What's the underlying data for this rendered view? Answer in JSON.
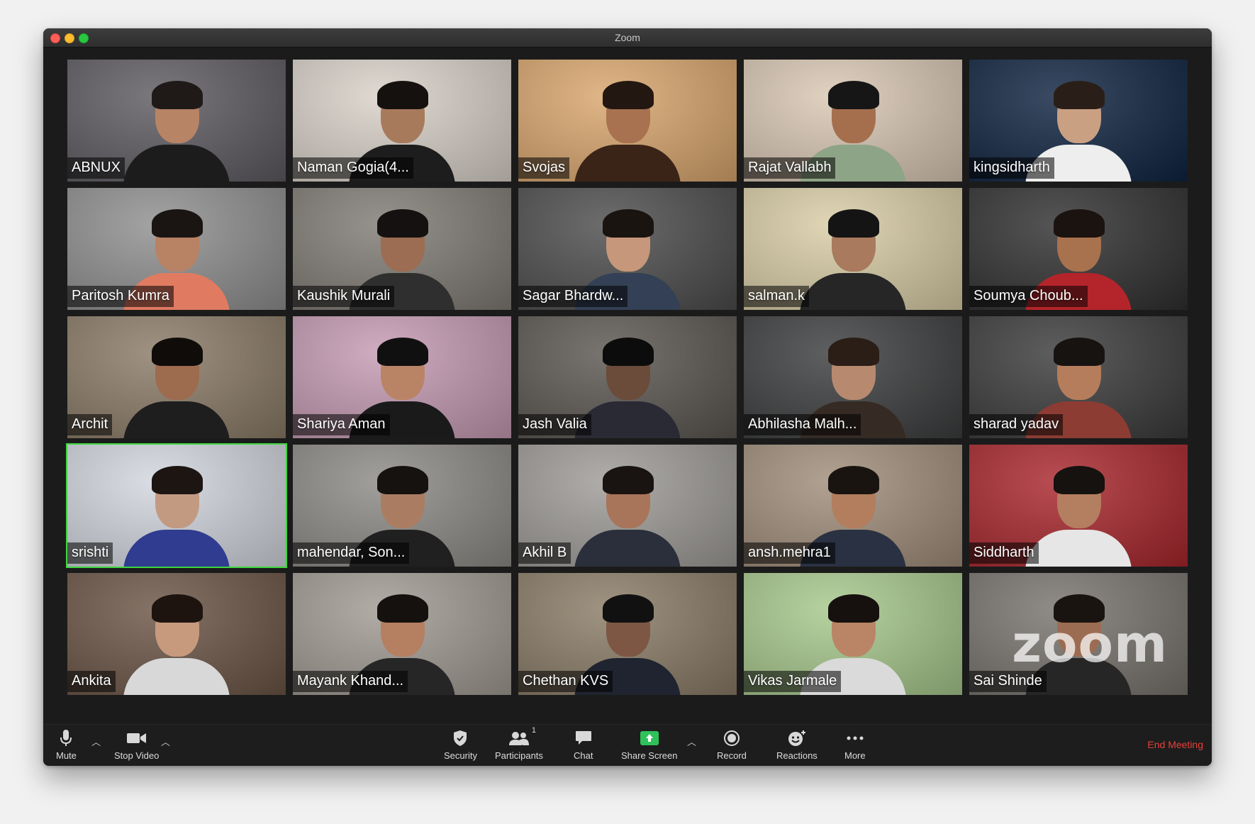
{
  "window": {
    "title": "Zoom"
  },
  "participants": [
    {
      "name": "ABNUX",
      "bg": "#5d5a60",
      "skin": "#b88466",
      "hair": "#1f1a18",
      "shirt": "#1c1c1c"
    },
    {
      "name": "Naman Gogia(4...",
      "bg": "#d8d1c8",
      "skin": "#a87a5c",
      "hair": "#15110f",
      "shirt": "#1d1d1d"
    },
    {
      "name": "Svojas",
      "bg": "#d9a66d",
      "skin": "#a8714f",
      "hair": "#231711",
      "shirt": "#3a2418"
    },
    {
      "name": "Rajat Vallabh",
      "bg": "#d9c7b3",
      "skin": "#a56f4e",
      "hair": "#161616",
      "shirt": "#8ea486"
    },
    {
      "name": "kingsidharth",
      "bg": "#0e2340",
      "skin": "#caa083",
      "hair": "#2a1f18",
      "shirt": "#eeeeee"
    },
    {
      "name": "Paritosh Kumra",
      "bg": "#8f8f8f",
      "skin": "#b88264",
      "hair": "#1a1512",
      "shirt": "#e07b62"
    },
    {
      "name": "Kaushik Murali",
      "bg": "#7f7a73",
      "skin": "#9c6d52",
      "hair": "#141110",
      "shirt": "#2f2f2f"
    },
    {
      "name": "Sagar Bhardw...",
      "bg": "#4c4c4c",
      "skin": "#c6977a",
      "hair": "#1a1410",
      "shirt": "#334055"
    },
    {
      "name": "salman.k",
      "bg": "#d9cda6",
      "skin": "#a97a5d",
      "hair": "#141414",
      "shirt": "#262626"
    },
    {
      "name": "Soumya Choub...",
      "bg": "#2f2f2f",
      "skin": "#a8724f",
      "hair": "#1a1310",
      "shirt": "#b3252a"
    },
    {
      "name": "Archit",
      "bg": "#8a7a66",
      "skin": "#9d6b4e",
      "hair": "#0f0c0a",
      "shirt": "#1e1e1e"
    },
    {
      "name": "Shariya Aman",
      "bg": "#c59ab2",
      "skin": "#b98466",
      "hair": "#111010",
      "shirt": "#1a1a1a"
    },
    {
      "name": "Jash Valia",
      "bg": "#5a5550",
      "skin": "#6b4b3a",
      "hair": "#0c0c0c",
      "shirt": "#2a2a35"
    },
    {
      "name": "Abhilasha Malh...",
      "bg": "#3b3c3d",
      "skin": "#b78a70",
      "hair": "#2a1e17",
      "shirt": "#352b24"
    },
    {
      "name": "sharad yadav",
      "bg": "#3a3a3a",
      "skin": "#b57d5b",
      "hair": "#171311",
      "shirt": "#8c3c33"
    },
    {
      "name": "srishti",
      "bg": "#d2d6de",
      "skin": "#c29a82",
      "hair": "#1c1512",
      "shirt": "#2f3c8f"
    },
    {
      "name": "mahendar, Son...",
      "bg": "#8c8a86",
      "skin": "#aa7d62",
      "hair": "#16120f",
      "shirt": "#202020"
    },
    {
      "name": "Akhil B",
      "bg": "#9e9b97",
      "skin": "#a8745a",
      "hair": "#191411",
      "shirt": "#2a2f3b"
    },
    {
      "name": "ansh.mehra1",
      "bg": "#a08d7a",
      "skin": "#b27e5e",
      "hair": "#1a1410",
      "shirt": "#2a3142"
    },
    {
      "name": "Siddharth",
      "bg": "#a8262c",
      "skin": "#b47e60",
      "hair": "#161210",
      "shirt": "#e6e6e6"
    },
    {
      "name": "Ankita",
      "bg": "#6b5445",
      "skin": "#c79a7e",
      "hair": "#1d1410",
      "shirt": "#d8d8d8"
    },
    {
      "name": "Mayank Khand...",
      "bg": "#a09a92",
      "skin": "#b57f62",
      "hair": "#15110f",
      "shirt": "#262626"
    },
    {
      "name": "Chethan KVS",
      "bg": "#8a7b66",
      "skin": "#7d5744",
      "hair": "#111111",
      "shirt": "#1f2430"
    },
    {
      "name": "Vikas Jarmale",
      "bg": "#a7c88c",
      "skin": "#b98566",
      "hair": "#16110e",
      "shirt": "#dadada"
    },
    {
      "name": "Sai Shinde",
      "bg": "#77736d",
      "skin": "#9c6c52",
      "hair": "#1a1411",
      "shirt": "#262626"
    }
  ],
  "active_speaker": "srishti",
  "watermark": "zoom",
  "toolbar": {
    "mute_label": "Mute",
    "stop_video_label": "Stop Video",
    "security_label": "Security",
    "participants_label": "Participants",
    "participants_count": "1",
    "chat_label": "Chat",
    "share_screen_label": "Share Screen",
    "record_label": "Record",
    "reactions_label": "Reactions",
    "more_label": "More",
    "end_meeting_label": "End Meeting"
  },
  "colors": {
    "active_speaker_border": "#3dd63d",
    "end_meeting": "#e8403a",
    "share_screen": "#2fc25b"
  }
}
